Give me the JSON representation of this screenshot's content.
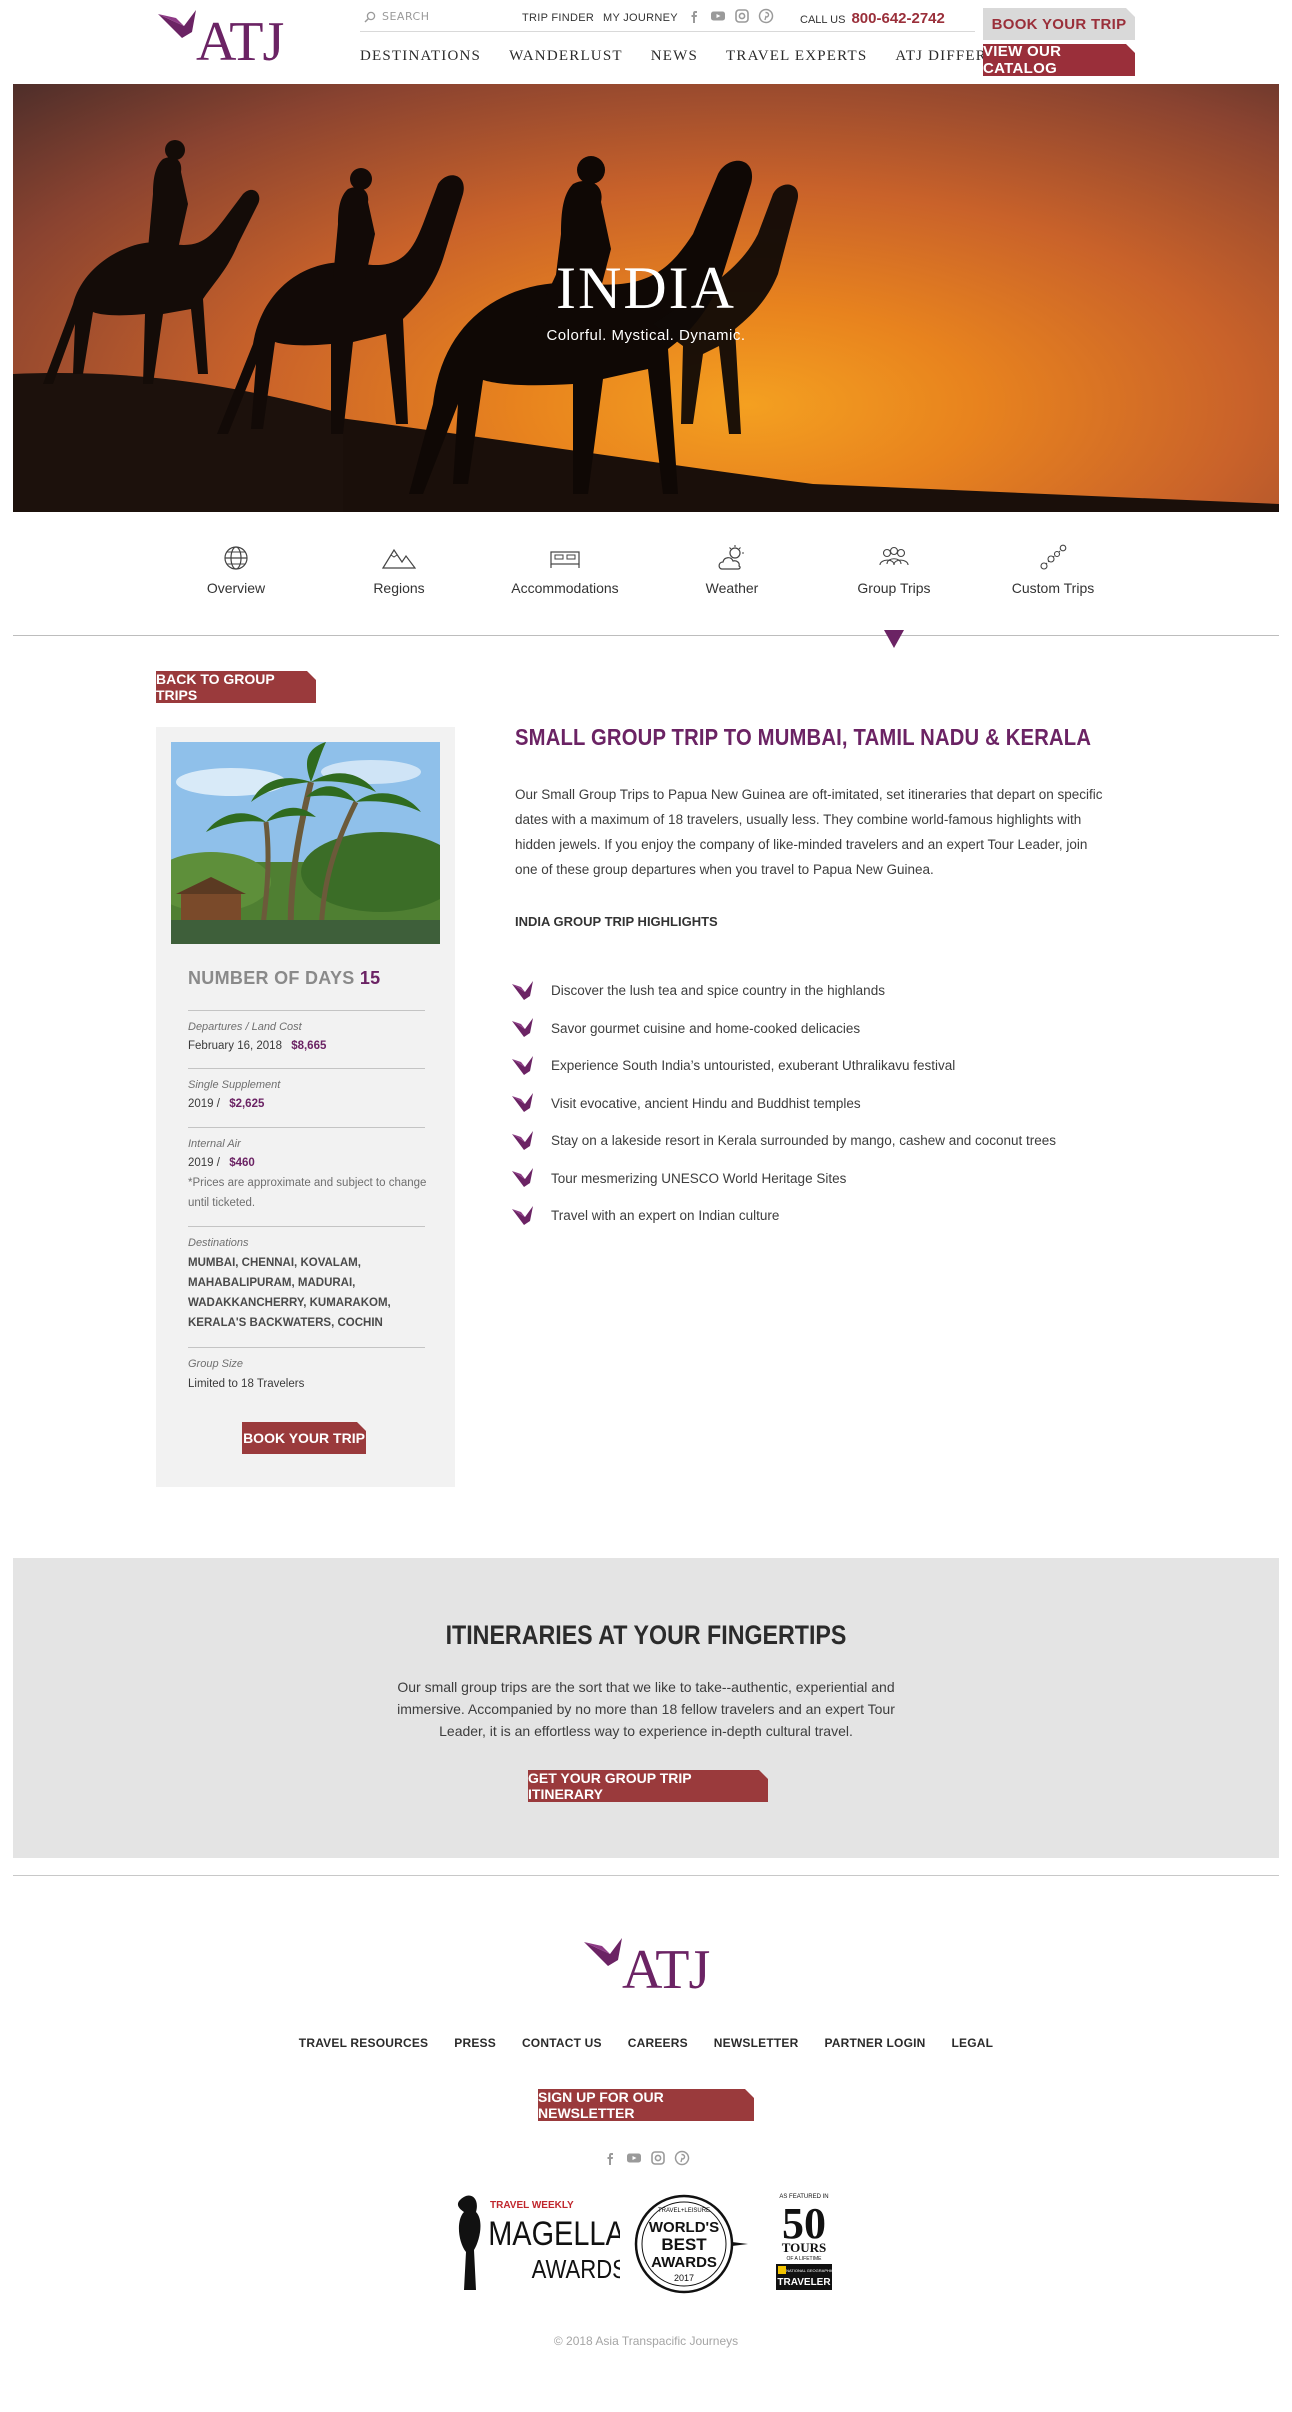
{
  "header": {
    "logo_text": "ATJ",
    "search_placeholder": "SEARCH",
    "util_links": {
      "trip_finder": "TRIP FINDER",
      "my_journey": "MY JOURNEY"
    },
    "call_us_label": "CALL US",
    "phone": "800-642-2742",
    "nav": [
      "DESTINATIONS",
      "WANDERLUST",
      "NEWS",
      "TRAVEL EXPERTS",
      "ATJ DIFFERENCE"
    ],
    "book_trip": "BOOK YOUR TRIP",
    "view_catalog": "VIEW OUR CATALOG",
    "social_icons": [
      "facebook-icon",
      "youtube-icon",
      "instagram-icon",
      "pinterest-icon"
    ]
  },
  "hero": {
    "title": "INDIA",
    "subtitle": "Colorful. Mystical. Dynamic."
  },
  "subnav": {
    "items": [
      {
        "label": "Overview",
        "icon": "globe-icon"
      },
      {
        "label": "Regions",
        "icon": "mountains-icon"
      },
      {
        "label": "Accommodations",
        "icon": "bed-icon"
      },
      {
        "label": "Weather",
        "icon": "sun-cloud-icon"
      },
      {
        "label": "Group Trips",
        "icon": "group-icon"
      },
      {
        "label": "Custom Trips",
        "icon": "route-icon"
      }
    ],
    "active": "Group Trips"
  },
  "content": {
    "back_button": "BACK TO GROUP TRIPS",
    "sidebar": {
      "days_label": "NUMBER OF DAYS",
      "days_value": "15",
      "departures_label": "Departures / Land Cost",
      "departures_date": "February 16, 2018",
      "departures_price": "$8,665",
      "supplement_label": "Single Supplement",
      "supplement_year": "2019 /",
      "supplement_price": "$2,625",
      "air_label": "Internal Air",
      "air_year": "2019 /",
      "air_price": "$460",
      "air_note": "*Prices are approximate and subject to change until ticketed.",
      "destinations_label": "Destinations",
      "destinations": "MUMBAI, CHENNAI, KOVALAM, MAHABALIPURAM, MADURAI, WADAKKANCHERRY, KUMARAKOM, KERALA'S BACKWATERS, COCHIN",
      "group_size_label": "Group Size",
      "group_size": "Limited to 18 Travelers",
      "book_button": "BOOK YOUR TRIP"
    },
    "title": "SMALL GROUP TRIP TO MUMBAI, TAMIL NADU & KERALA",
    "description": "Our Small Group Trips to Papua New Guinea are oft-imitated, set itineraries that depart on specific dates with a maximum of 18 travelers, usually less. They combine world-famous highlights with hidden jewels. If you enjoy the company of like-minded travelers and an expert Tour Leader, join one of these group departures when you travel to Papua New Guinea.",
    "highlights_heading": "INDIA GROUP TRIP HIGHLIGHTS",
    "highlights": [
      "Discover the lush tea and spice country in the highlands",
      "Savor gourmet cuisine and home-cooked delicacies",
      "Experience South India’s untouristed, exuberant Uthralikavu festival",
      "Visit evocative, ancient Hindu and Buddhist temples",
      "Stay on a lakeside resort in Kerala surrounded by mango, cashew and coconut trees",
      "Tour mesmerizing UNESCO World Heritage Sites",
      "Travel with an expert on Indian culture"
    ]
  },
  "itineraries": {
    "title": "ITINERARIES AT YOUR FINGERTIPS",
    "text": "Our small group trips are the sort that we like to take--authentic, experiential and immersive. Accompanied by no more than 18 fellow travelers and an expert Tour Leader, it is an effortless way to experience in-depth cultural travel.",
    "button": "GET YOUR GROUP TRIP ITINERARY"
  },
  "footer": {
    "logo_text": "ATJ",
    "links": [
      "TRAVEL RESOURCES",
      "PRESS",
      "CONTACT US",
      "CAREERS",
      "NEWSLETTER",
      "PARTNER LOGIN",
      "LEGAL"
    ],
    "newsletter_button": "SIGN UP FOR OUR NEWSLETTER",
    "awards": {
      "magellan_top": "TRAVEL WEEKLY",
      "magellan_line1": "MAGELLAN",
      "magellan_line2": "AWARDS",
      "wba_top": "TRAVEL+LEISURE",
      "wba_line1": "WORLD'S",
      "wba_line2": "BEST",
      "wba_line3": "AWARDS",
      "wba_year": "2017",
      "ng_top": "AS FEATURED IN",
      "ng_num": "50",
      "ng_tours": "TOURS",
      "ng_sub": "OF A LIFETIME",
      "ng_brand1": "NATIONAL GEOGRAPHIC",
      "ng_brand2": "TRAVELER"
    },
    "copyright": "© 2018 Asia Transpacific Journeys"
  },
  "colors": {
    "brand_purple": "#6b2364",
    "accent_red": "#9a3a3c",
    "band_grey": "#e4e4e4"
  }
}
